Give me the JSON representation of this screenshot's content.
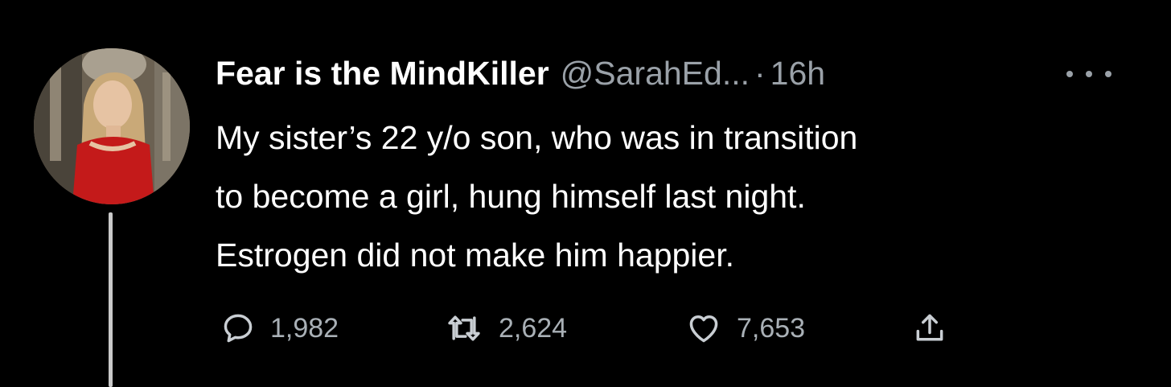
{
  "tweet": {
    "display_name": "Fear is the MindKiller",
    "handle": "@SarahEd...",
    "separator": "·",
    "time": "16h",
    "body_lines": [
      "My sister’s 22 y/o son, who was in transition",
      "to become a girl, hung himself last night.",
      "Estrogen did not make him happier."
    ],
    "more_icon": "more-horizontal-icon"
  },
  "actions": {
    "reply": {
      "icon": "reply-bubble-icon",
      "count": "1,982"
    },
    "retweet": {
      "icon": "retweet-icon",
      "count": "2,624"
    },
    "like": {
      "icon": "heart-icon",
      "count": "7,653"
    },
    "share": {
      "icon": "share-upload-icon"
    }
  },
  "colors": {
    "background": "#000000",
    "text_primary": "#ffffff",
    "text_secondary": "#9aa1a8",
    "thread_line": "#c9c9c9"
  }
}
